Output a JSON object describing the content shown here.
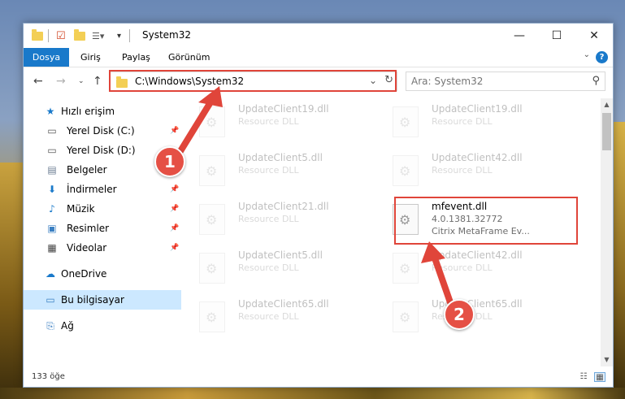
{
  "titlebar": {
    "title": "System32",
    "minimize_label": "—",
    "maximize_label": "☐",
    "close_label": "✕"
  },
  "ribbon": {
    "tabs": [
      {
        "label": "Dosya"
      },
      {
        "label": "Giriş"
      },
      {
        "label": "Paylaş"
      },
      {
        "label": "Görünüm"
      }
    ],
    "help_label": "?"
  },
  "nav": {
    "back_icon": "back-arrow-icon",
    "forward_icon": "forward-arrow-icon",
    "up_icon": "up-arrow-icon",
    "address": "C:\\Windows\\System32",
    "search_placeholder": "Ara: System32"
  },
  "sidebar": {
    "items": [
      {
        "label": "Hızlı erişim",
        "icon": "star-icon"
      },
      {
        "label": "Yerel Disk (C:)",
        "icon": "drive-icon",
        "pinned": true
      },
      {
        "label": "Yerel Disk (D:)",
        "icon": "drive-icon"
      },
      {
        "label": "Belgeler",
        "icon": "documents-icon"
      },
      {
        "label": "İndirmeler",
        "icon": "download-icon",
        "pinned": true
      },
      {
        "label": "Müzik",
        "icon": "music-icon",
        "pinned": true
      },
      {
        "label": "Resimler",
        "icon": "pictures-icon",
        "pinned": true
      },
      {
        "label": "Videolar",
        "icon": "videos-icon",
        "pinned": true
      },
      {
        "label": "OneDrive",
        "icon": "cloud-icon"
      },
      {
        "label": "Bu bilgisayar",
        "icon": "computer-icon",
        "selected": true
      },
      {
        "label": "Ağ",
        "icon": "network-icon"
      }
    ]
  },
  "files": [
    {
      "name": "UpdateClient19.dll",
      "line1": "Resource DLL",
      "line2": ""
    },
    {
      "name": "UpdateClient19.dll",
      "line1": "Resource DLL",
      "line2": ""
    },
    {
      "name": "UpdateClient5.dll",
      "line1": "Resource DLL",
      "line2": ""
    },
    {
      "name": "UpdateClient42.dll",
      "line1": "Resource DLL",
      "line2": ""
    },
    {
      "name": "UpdateClient21.dll",
      "line1": "Resource DLL",
      "line2": ""
    },
    {
      "name": "mfevent.dll",
      "line1": "4.0.1381.32772",
      "line2": "Citrix MetaFrame Ev...",
      "highlighted": true
    },
    {
      "name": "UpdateClient5.dll",
      "line1": "Resource DLL",
      "line2": ""
    },
    {
      "name": "UpdateClient42.dll",
      "line1": "Resource DLL",
      "line2": ""
    },
    {
      "name": "UpdateClient65.dll",
      "line1": "Resource DLL",
      "line2": ""
    },
    {
      "name": "UpdateClient65.dll",
      "line1": "Resource DLL",
      "line2": ""
    }
  ],
  "status": {
    "count": "133 öğe"
  },
  "annotations": {
    "callout1": "1",
    "callout2": "2",
    "color": "#e0453a"
  },
  "colors": {
    "accent": "#1979ca",
    "selected_bg": "#cce8ff"
  }
}
